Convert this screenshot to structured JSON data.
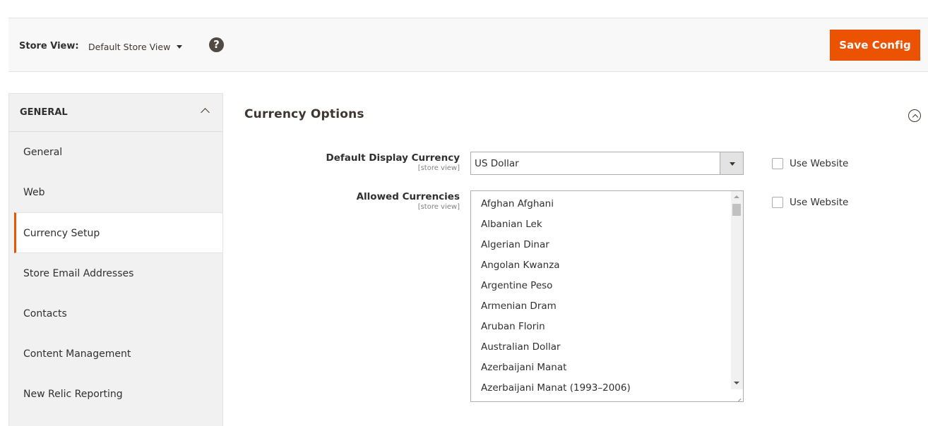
{
  "store_bar": {
    "label": "Store View:",
    "selected_store": "Default Store View",
    "help_icon": "?",
    "save_button": "Save Config"
  },
  "sidebar": {
    "section_title": "GENERAL",
    "items": [
      {
        "label": "General",
        "active": false
      },
      {
        "label": "Web",
        "active": false
      },
      {
        "label": "Currency Setup",
        "active": true
      },
      {
        "label": "Store Email Addresses",
        "active": false
      },
      {
        "label": "Contacts",
        "active": false
      },
      {
        "label": "Content Management",
        "active": false
      },
      {
        "label": "New Relic Reporting",
        "active": false
      }
    ]
  },
  "main": {
    "section_title": "Currency Options",
    "fields": {
      "default_display_currency": {
        "label": "Default Display Currency",
        "scope": "[store view]",
        "value": "US Dollar",
        "use_website_label": "Use Website",
        "use_website_checked": false
      },
      "allowed_currencies": {
        "label": "Allowed Currencies",
        "scope": "[store view]",
        "options": [
          "Afghan Afghani",
          "Albanian Lek",
          "Algerian Dinar",
          "Angolan Kwanza",
          "Argentine Peso",
          "Armenian Dram",
          "Aruban Florin",
          "Australian Dollar",
          "Azerbaijani Manat",
          "Azerbaijani Manat (1993–2006)"
        ],
        "use_website_label": "Use Website",
        "use_website_checked": false
      }
    }
  },
  "colors": {
    "accent": "#eb5202",
    "help_icon_bg": "#514943"
  }
}
